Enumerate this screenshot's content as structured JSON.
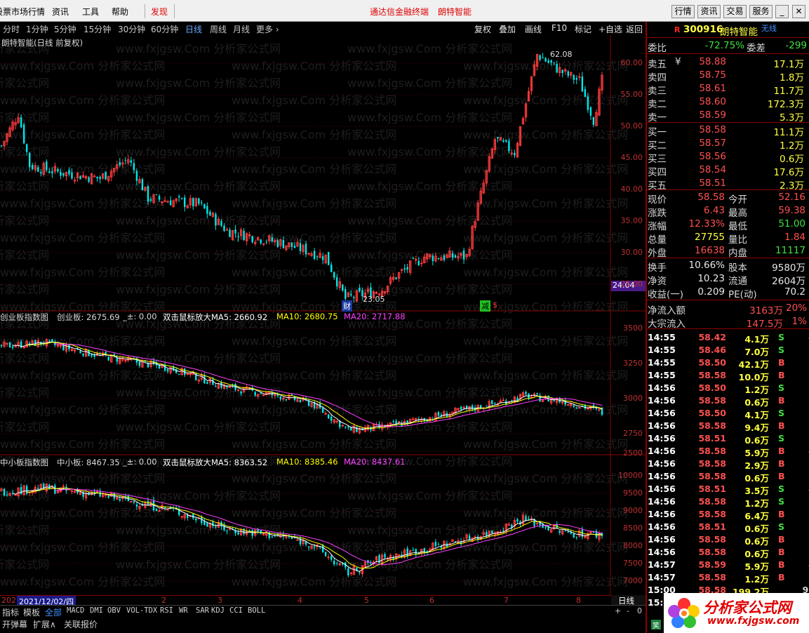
{
  "window": {
    "menu": [
      {
        "label": "股票市场行情"
      },
      {
        "label": "资讯"
      },
      {
        "label": "工具"
      },
      {
        "label": "帮助"
      }
    ],
    "discover": "发现",
    "center_title": "通达信金融终端",
    "center_stock": "朗特智能",
    "top_buttons": [
      {
        "label": "行情"
      },
      {
        "label": "资讯"
      },
      {
        "label": "交易"
      },
      {
        "label": "服务"
      }
    ],
    "win_buttons": [
      {
        "label": "_"
      },
      {
        "label": "□"
      },
      {
        "label": "✕"
      }
    ]
  },
  "toolbar": {
    "periods": [
      {
        "label": "分时"
      },
      {
        "label": "1分钟"
      },
      {
        "label": "5分钟"
      },
      {
        "label": "15分钟"
      },
      {
        "label": "30分钟"
      },
      {
        "label": "60分钟"
      },
      {
        "label": "日线"
      },
      {
        "label": "周线"
      },
      {
        "label": "月线"
      },
      {
        "label": "更多 ›"
      }
    ],
    "active_period": "日线",
    "tools": [
      {
        "label": "复权"
      },
      {
        "label": "叠加"
      },
      {
        "label": "画线"
      },
      {
        "label": "F10"
      },
      {
        "label": "标记"
      },
      {
        "label": "+自选"
      },
      {
        "label": "返回"
      }
    ]
  },
  "watermark": "www.fxjgsw.Com 分析家公式网",
  "main_chart": {
    "title": "朗特智能(日线 前复权)",
    "high_label": "62.08",
    "low_label": "23.05",
    "yticks": [
      "60.00",
      "55.00",
      "50.00",
      "45.00",
      "40.00",
      "35.00",
      "30.00",
      "25.00"
    ],
    "current_price_tag": "24.04",
    "markers": [
      {
        "label": "财"
      },
      {
        "label": "减"
      },
      {
        "label": "$"
      }
    ]
  },
  "panel1": {
    "name": "创业板指数图",
    "index_label": "创业板: 2675.69",
    "change": "_±: 0.00",
    "ma5": "双击鼠标放大MA5: 2660.92",
    "ma10": "MA10: 2680.75",
    "ma20": "MA20: 2717.88",
    "yticks": [
      "3500",
      "3250",
      "3000",
      "2750",
      "2500"
    ]
  },
  "panel2": {
    "name": "中小板指数图",
    "index_label": "中小板: 8467.35",
    "change": "_±: 0.00",
    "ma5": "双击鼠标放大MA5: 8363.52",
    "ma10": "MA10: 8385.46",
    "ma20": "MA20: 8437.61",
    "yticks": [
      "10000",
      "9500",
      "9000",
      "8500",
      "8000",
      "7500",
      "7000"
    ]
  },
  "timeline": {
    "prefix": "202",
    "selected_date": "2021/12/02/四",
    "months": [
      "2",
      "3",
      "4",
      "5",
      "6",
      "7",
      "8"
    ],
    "period": "日线"
  },
  "bottom_tabs": [
    {
      "label": "指标"
    },
    {
      "label": "模板"
    },
    {
      "label": "全部"
    },
    {
      "label": "MACD"
    },
    {
      "label": "DMI"
    },
    {
      "label": "OBV"
    },
    {
      "label": "VOL-TDX"
    },
    {
      "label": "RSI"
    },
    {
      "label": "WR"
    },
    {
      "label": "SAR"
    },
    {
      "label": "KDJ"
    },
    {
      "label": "CCI"
    },
    {
      "label": "BOLL"
    }
  ],
  "bottom_controls": [
    "+",
    "-",
    "0"
  ],
  "status_items": [
    {
      "label": "开弹幕"
    },
    {
      "label": "扩展∧"
    },
    {
      "label": "关联报价"
    }
  ],
  "stock": {
    "flag": "R",
    "code": "300916",
    "name": "朗特智能",
    "tag": "无线"
  },
  "quote": {
    "weibi": {
      "label": "委比",
      "value": "-72.75%",
      "label2": "委差",
      "value2": "-299"
    },
    "asks": [
      {
        "label": "卖五",
        "price": "58.88",
        "vol": "17.1万"
      },
      {
        "label": "卖四",
        "price": "58.75",
        "vol": "1.8万"
      },
      {
        "label": "卖三",
        "price": "58.61",
        "vol": "11.7万"
      },
      {
        "label": "卖二",
        "price": "58.60",
        "vol": "172.3万"
      },
      {
        "label": "卖一",
        "price": "58.59",
        "vol": "5.3万"
      }
    ],
    "ask_symbol": "¥",
    "bids": [
      {
        "label": "买一",
        "price": "58.58",
        "vol": "11.1万"
      },
      {
        "label": "买二",
        "price": "58.57",
        "vol": "1.2万"
      },
      {
        "label": "买三",
        "price": "58.56",
        "vol": "0.6万"
      },
      {
        "label": "买四",
        "price": "58.54",
        "vol": "17.6万"
      },
      {
        "label": "买五",
        "price": "58.51",
        "vol": "2.3万"
      }
    ],
    "stats": [
      {
        "l1": "现价",
        "v1": "58.58",
        "l2": "今开",
        "v2": "52.16",
        "c1": "#ff5050",
        "c2": "#ff5050"
      },
      {
        "l1": "涨跌",
        "v1": "6.43",
        "l2": "最高",
        "v2": "59.38",
        "c1": "#ff5050",
        "c2": "#ff5050"
      },
      {
        "l1": "涨幅",
        "v1": "12.33%",
        "l2": "最低",
        "v2": "51.00",
        "c1": "#ff5050",
        "c2": "#40e040"
      },
      {
        "l1": "总量",
        "v1": "27755",
        "l2": "量比",
        "v2": "1.84",
        "c1": "#ffff40",
        "c2": "#ff5050"
      },
      {
        "l1": "外盘",
        "v1": "16638",
        "l2": "内盘",
        "v2": "11117",
        "c1": "#ff5050",
        "c2": "#40e040"
      }
    ],
    "fund": [
      {
        "l1": "换手",
        "v1": "10.66%",
        "l2": "股本",
        "v2": "9580万"
      },
      {
        "l1": "净资",
        "v1": "10.23",
        "l2": "流通",
        "v2": "2604万"
      },
      {
        "l1": "收益(一)",
        "v1": "0.209",
        "l2": "PE(动)",
        "v2": "70.2"
      }
    ],
    "flow": [
      {
        "label": "净流入额",
        "value": "3163万",
        "pct": "20%"
      },
      {
        "label": "大宗流入",
        "value": "147.5万",
        "pct": "1%"
      }
    ]
  },
  "ticks": [
    {
      "t": "14:55",
      "p": "58.42",
      "v": "4.1万",
      "s": "S",
      "n": "4"
    },
    {
      "t": "14:55",
      "p": "58.46",
      "v": "7.0万",
      "s": "S",
      "n": "3"
    },
    {
      "t": "14:55",
      "p": "58.50",
      "v": "42.1万",
      "s": "B",
      "n": "1"
    },
    {
      "t": "14:55",
      "p": "58.58",
      "v": "10.0万",
      "s": "B",
      "n": "3"
    },
    {
      "t": "14:56",
      "p": "58.50",
      "v": "1.2万",
      "s": "S",
      "n": "3"
    },
    {
      "t": "14:56",
      "p": "58.58",
      "v": "0.6万",
      "s": "B",
      "n": "1"
    },
    {
      "t": "14:56",
      "p": "58.50",
      "v": "4.1万",
      "s": "S",
      "n": "3"
    },
    {
      "t": "14:56",
      "p": "58.58",
      "v": "9.4万",
      "s": "B",
      "n": "5"
    },
    {
      "t": "14:56",
      "p": "58.51",
      "v": "0.6万",
      "s": "S",
      "n": "1"
    },
    {
      "t": "14:56",
      "p": "58.58",
      "v": "5.9万",
      "s": "B",
      "n": "4"
    },
    {
      "t": "14:56",
      "p": "58.58",
      "v": "2.9万",
      "s": "B",
      "n": "2"
    },
    {
      "t": "14:56",
      "p": "58.58",
      "v": "0.6万",
      "s": "B",
      "n": "1"
    },
    {
      "t": "14:56",
      "p": "58.51",
      "v": "3.5万",
      "s": "S",
      "n": "4"
    },
    {
      "t": "14:56",
      "p": "58.58",
      "v": "1.2万",
      "s": "S",
      "n": "1"
    },
    {
      "t": "14:56",
      "p": "58.58",
      "v": "6.4万",
      "s": "B",
      "n": "3"
    },
    {
      "t": "14:56",
      "p": "58.51",
      "v": "0.6万",
      "s": "S",
      "n": "1"
    },
    {
      "t": "14:56",
      "p": "58.58",
      "v": "0.6万",
      "s": "B",
      "n": "1"
    },
    {
      "t": "14:56",
      "p": "58.58",
      "v": "0.6万",
      "s": "B",
      "n": "1"
    },
    {
      "t": "14:57",
      "p": "58.59",
      "v": "5.9万",
      "s": "B",
      "n": "4"
    },
    {
      "t": "14:57",
      "p": "58.58",
      "v": "1.2万",
      "s": "B",
      "n": "2"
    },
    {
      "t": "15:00",
      "p": "58.58",
      "v": "199.2万",
      "s": "",
      "n": "97"
    }
  ],
  "status_right": "15:",
  "status_corner": "笑",
  "logo": {
    "title": "分析家公式网",
    "url": "www.fxjgsw.com"
  },
  "colors": {
    "up": "#ff3c3c",
    "down": "#00e8e8",
    "ma5": "#ffffff",
    "ma10": "#ffff00",
    "ma20": "#ff40ff",
    "grid": "#8b0000"
  }
}
